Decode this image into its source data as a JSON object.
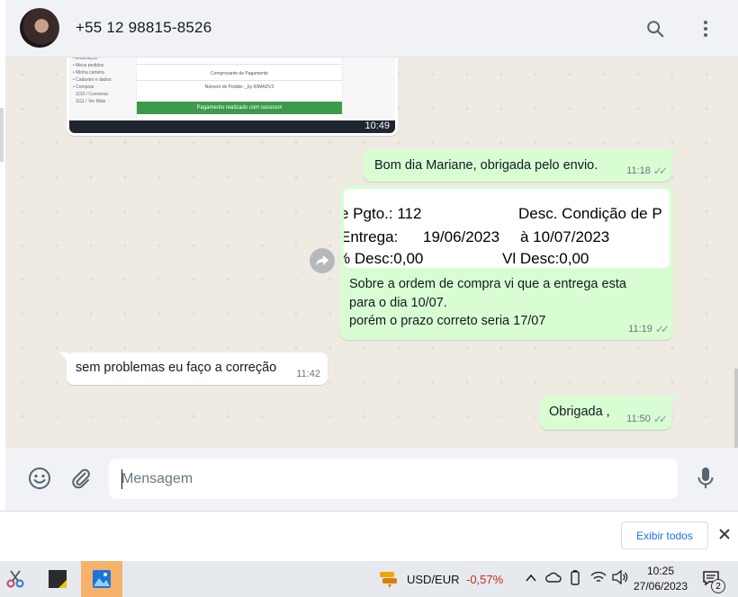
{
  "header": {
    "contact_name": "+55 12 98815-8526",
    "search_icon": "search-icon",
    "menu_icon": "more-vertical-icon"
  },
  "image_message": {
    "time": "10:49",
    "panel_title": "Comprovante de Pagamento",
    "panel_order": "Número do Pedido: _by 00MADV2",
    "success_text": "Pagamento realizado com sucesso!"
  },
  "messages": [
    {
      "direction": "out",
      "text": "Bom dia Mariane, obrigada pelo envio.",
      "time": "11:18",
      "status": "read"
    },
    {
      "direction": "out",
      "quote_lines": [
        "e Pgto.: 112",
        "Desc. Condição de P",
        "Entrega:",
        "19/06/2023",
        "à 10/07/2023",
        "% Desc:0,00",
        "Vl Desc:0,00"
      ],
      "text_lines": [
        "Sobre a ordem de compra vi que a entrega esta",
        "para o dia 10/07.",
        "porém o prazo correto seria 17/07"
      ],
      "time": "11:19",
      "status": "read"
    },
    {
      "direction": "in",
      "text": "sem problemas eu faço a correção",
      "time": "11:42"
    },
    {
      "direction": "out",
      "text": "Obrigada ,",
      "time": "11:50",
      "status": "read"
    }
  ],
  "composer": {
    "placeholder": "Mensagem",
    "emoji_icon": "emoji-icon",
    "attach_icon": "paperclip-icon",
    "mic_icon": "microphone-icon"
  },
  "download_bar": {
    "show_all_label": "Exibir todos"
  },
  "taskbar": {
    "ticker_label": "USD/EUR",
    "ticker_change": "-0,57%",
    "time": "10:25",
    "date": "27/06/2023",
    "notification_count": "2"
  },
  "colors": {
    "outgoing_bubble": "#d9fdd3",
    "incoming_bubble": "#ffffff",
    "chat_background": "#efeae2",
    "accent_link": "#1a73e8",
    "negative": "#c42b1c"
  }
}
